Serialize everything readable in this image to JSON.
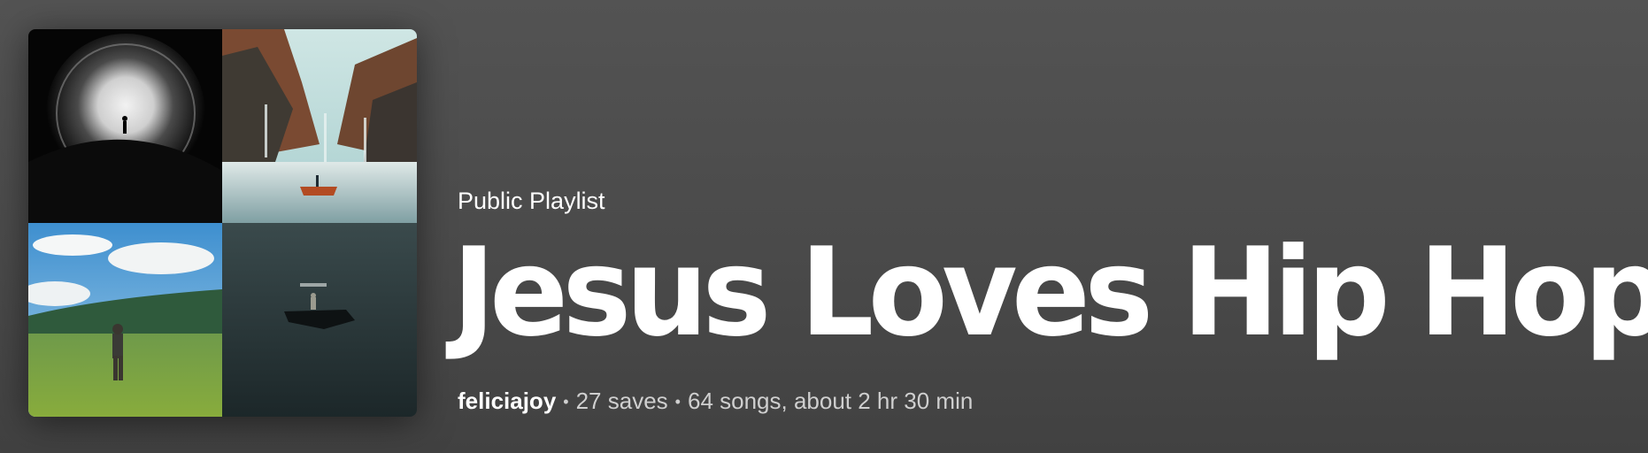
{
  "playlist": {
    "type_label": "Public Playlist",
    "title": "Jesus Loves Hip Hop",
    "owner": "feliciajoy",
    "saves": "27 saves",
    "songs_duration": "64 songs, about 2 hr 30 min",
    "separator": "•"
  },
  "cover": {
    "tiles": [
      "album-art-figure-in-light-ring",
      "album-art-boat-in-mountain-lake",
      "album-art-man-in-meadow",
      "album-art-figure-on-dark-sea"
    ]
  },
  "colors": {
    "background": "#4a4a4a",
    "text_primary": "#ffffff",
    "text_secondary": "#cfcfcf"
  }
}
